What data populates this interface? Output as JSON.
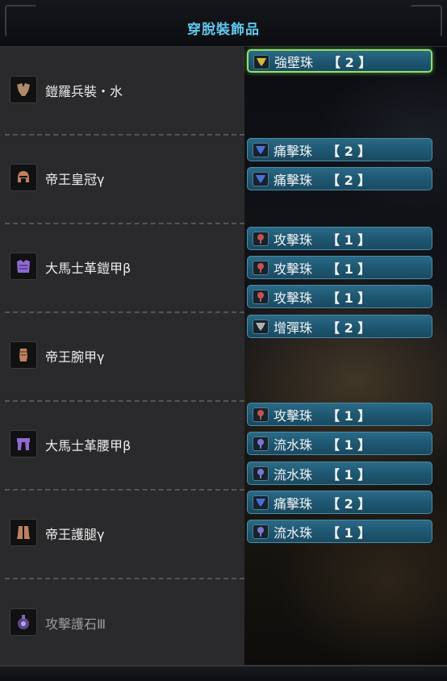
{
  "window": {
    "title": "穿脫裝飾品"
  },
  "colors": {
    "title": "#5fc8ee",
    "panel": "#2a2a2d",
    "decoration_fill": "#1e5670",
    "selected_border": "#8fe06a"
  },
  "gear": [
    {
      "name": "鎧羅兵裝・水",
      "icon": "arms-armor-icon",
      "icon_color": "#b08a6a"
    },
    {
      "name": "帝王皇冠γ",
      "icon": "helm-armor-icon",
      "icon_color": "#c08060"
    },
    {
      "name": "大馬士革鎧甲β",
      "icon": "chest-armor-icon",
      "icon_color": "#8e6ad0"
    },
    {
      "name": "帝王腕甲γ",
      "icon": "gauntlet-armor-icon",
      "icon_color": "#c08060"
    },
    {
      "name": "大馬士革腰甲β",
      "icon": "waist-armor-icon",
      "icon_color": "#8e6ad0"
    },
    {
      "name": "帝王護腿γ",
      "icon": "legs-armor-icon",
      "icon_color": "#c08060"
    },
    {
      "name": "攻擊護石Ⅲ",
      "icon": "charm-icon",
      "icon_color": "#8e6ad0"
    }
  ],
  "decorations": [
    {
      "label": "強壁珠",
      "level": "【 2 】",
      "icon": "yellow-jewel-icon",
      "jewel_color": "#d6b83a",
      "selected": true
    },
    {
      "label": "痛擊珠",
      "level": "【 2 】",
      "icon": "blue-jewel-icon",
      "jewel_color": "#4a6fd8",
      "selected": false
    },
    {
      "label": "痛擊珠",
      "level": "【 2 】",
      "icon": "blue-jewel-icon",
      "jewel_color": "#4a6fd8",
      "selected": false
    },
    {
      "label": "攻擊珠",
      "level": "【 1 】",
      "icon": "red-jewel-icon",
      "jewel_color": "#c85050",
      "selected": false
    },
    {
      "label": "攻擊珠",
      "level": "【 1 】",
      "icon": "red-jewel-icon",
      "jewel_color": "#c85050",
      "selected": false
    },
    {
      "label": "攻擊珠",
      "level": "【 1 】",
      "icon": "red-jewel-icon",
      "jewel_color": "#c85050",
      "selected": false
    },
    {
      "label": "增彈珠",
      "level": "【 2 】",
      "icon": "grey-jewel-icon",
      "jewel_color": "#b0b0b0",
      "selected": false
    },
    {
      "label": "攻擊珠",
      "level": "【 1 】",
      "icon": "red-jewel-icon",
      "jewel_color": "#c85050",
      "selected": false
    },
    {
      "label": "流水珠",
      "level": "【 1 】",
      "icon": "violet-jewel-icon",
      "jewel_color": "#7a78d0",
      "selected": false
    },
    {
      "label": "流水珠",
      "level": "【 1 】",
      "icon": "violet-jewel-icon",
      "jewel_color": "#7a78d0",
      "selected": false
    },
    {
      "label": "痛擊珠",
      "level": "【 2 】",
      "icon": "blue-jewel-icon",
      "jewel_color": "#4a6fd8",
      "selected": false
    },
    {
      "label": "流水珠",
      "level": "【 1 】",
      "icon": "violet-jewel-icon",
      "jewel_color": "#7a78d0",
      "selected": false
    }
  ]
}
